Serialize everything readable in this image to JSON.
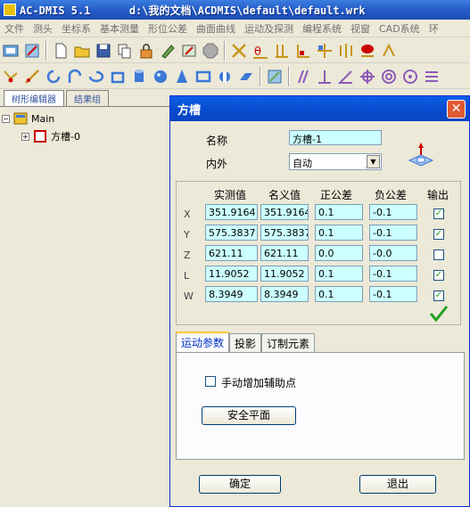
{
  "window": {
    "title": "AC-DMIS 5.1      d:\\我的文档\\ACDMIS\\default\\default.wrk"
  },
  "menu": [
    "文件",
    "测头",
    "坐标系",
    "基本测量",
    "形位公差",
    "曲面曲线",
    "运动及探测",
    "编程系统",
    "视窗",
    "CAD系统",
    "环"
  ],
  "left_pane": {
    "tabs": [
      "树形编辑器",
      "结果组"
    ],
    "tree": {
      "root": "Main",
      "child": "方槽-0"
    }
  },
  "dialog": {
    "title": "方槽",
    "name_label": "名称",
    "name_value": "方槽-1",
    "inout_label": "内外",
    "inout_value": "自动",
    "columns": [
      "实测值",
      "名义值",
      "正公差",
      "负公差",
      "输出"
    ],
    "rows": [
      {
        "label": "X",
        "measured": "351.9164",
        "nominal": "351.9164",
        "plus_tol": "0.1",
        "minus_tol": "-0.1",
        "output": true
      },
      {
        "label": "Y",
        "measured": "575.3837",
        "nominal": "575.3837",
        "plus_tol": "0.1",
        "minus_tol": "-0.1",
        "output": true
      },
      {
        "label": "Z",
        "measured": "621.11",
        "nominal": "621.11",
        "plus_tol": "0.0",
        "minus_tol": "-0.0",
        "output": false
      },
      {
        "label": "L",
        "measured": "11.9052",
        "nominal": "11.9052",
        "plus_tol": "0.1",
        "minus_tol": "-0.1",
        "output": true
      },
      {
        "label": "W",
        "measured": "8.3949",
        "nominal": "8.3949",
        "plus_tol": "0.1",
        "minus_tol": "-0.1",
        "output": true
      }
    ],
    "tabs": [
      "运动参数",
      "投影",
      "订制元素"
    ],
    "add_aux_points_label": "手动增加辅助点",
    "add_aux_points_checked": false,
    "safe_plane_button": "安全平面",
    "ok_button": "确定",
    "exit_button": "退出"
  }
}
